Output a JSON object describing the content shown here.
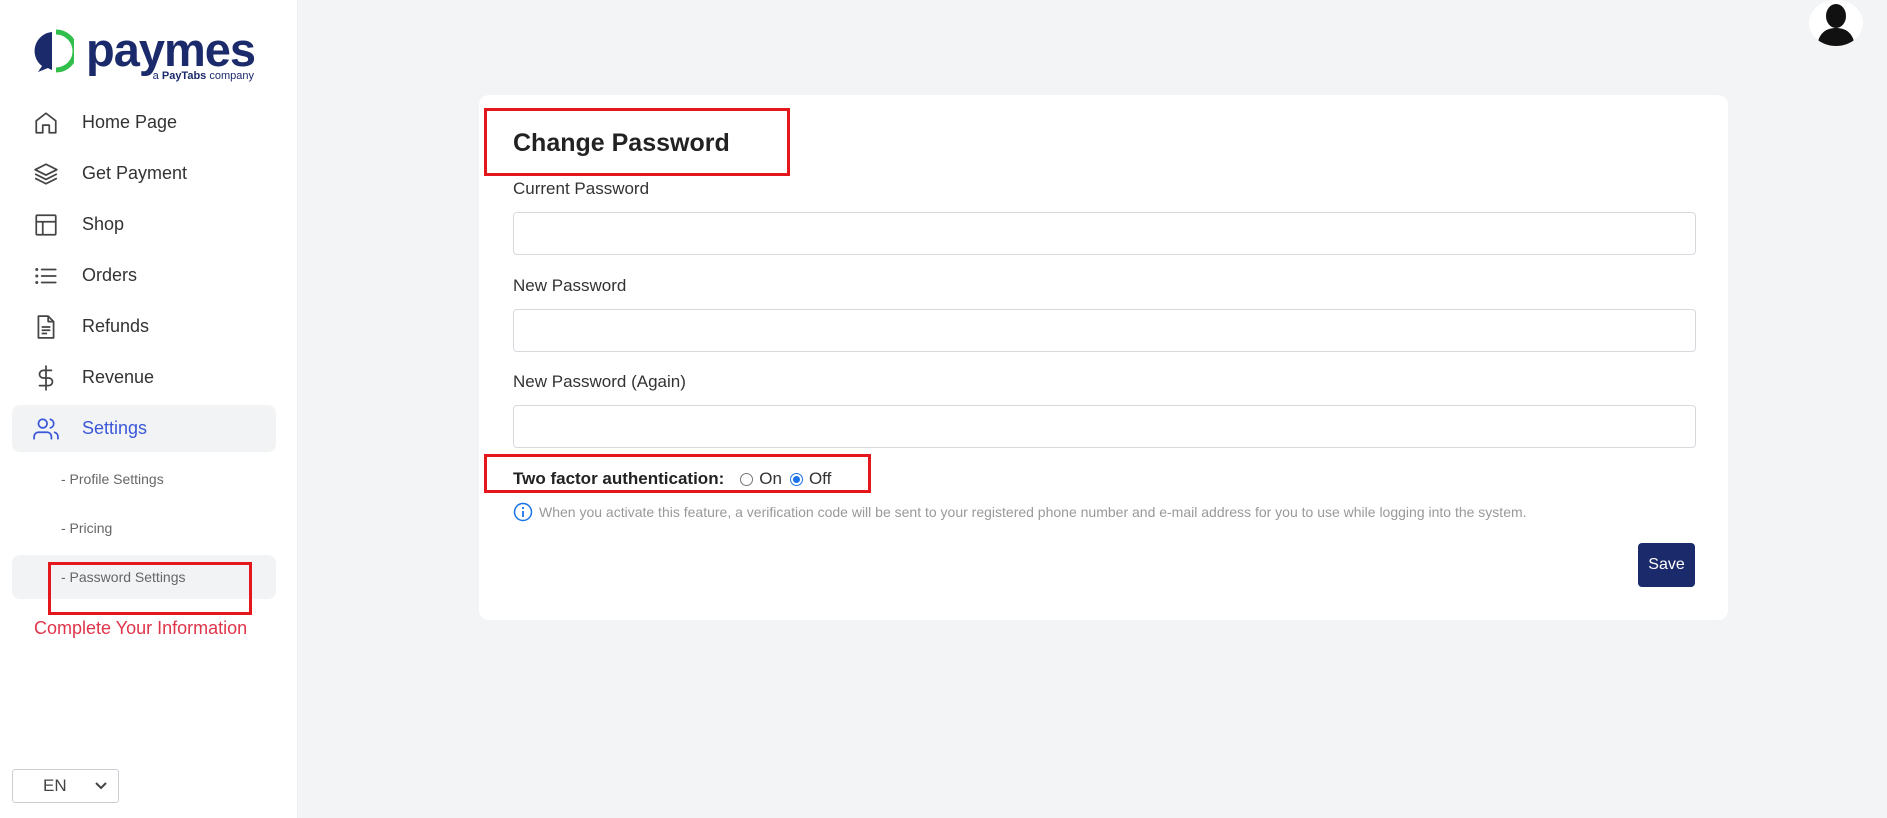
{
  "brand": {
    "name": "paymes",
    "tagline_prefix": "a",
    "tagline_brand": "PayTabs",
    "tagline_suffix": "company",
    "color": "#1b2a6b"
  },
  "sidebar": {
    "items": [
      {
        "label": "Home Page",
        "icon": "home-icon"
      },
      {
        "label": "Get Payment",
        "icon": "layers-icon"
      },
      {
        "label": "Shop",
        "icon": "layout-icon"
      },
      {
        "label": "Orders",
        "icon": "list-icon"
      },
      {
        "label": "Refunds",
        "icon": "document-icon"
      },
      {
        "label": "Revenue",
        "icon": "dollar-icon"
      },
      {
        "label": "Settings",
        "icon": "users-icon",
        "active": true
      }
    ],
    "sub_items": [
      {
        "label": "- Profile Settings"
      },
      {
        "label": "- Pricing"
      },
      {
        "label": "- Password Settings",
        "active": true
      }
    ],
    "complete_info": "Complete Your Information",
    "language": "EN"
  },
  "form": {
    "title": "Change Password",
    "current_password_label": "Current Password",
    "new_password_label": "New Password",
    "new_password_again_label": "New Password (Again)",
    "current_password_value": "",
    "new_password_value": "",
    "new_password_again_value": "",
    "two_factor_label": "Two factor authentication:",
    "two_factor_on": "On",
    "two_factor_off": "Off",
    "two_factor_selected": "Off",
    "info_text": "When you activate this feature, a verification code will be sent to your registered phone number and e-mail address for you to use while logging into the system.",
    "save_label": "Save"
  },
  "colors": {
    "accent": "#3b57d9",
    "warning": "#e0344a",
    "annotation": "#e4171c",
    "button": "#1b2a6b"
  }
}
